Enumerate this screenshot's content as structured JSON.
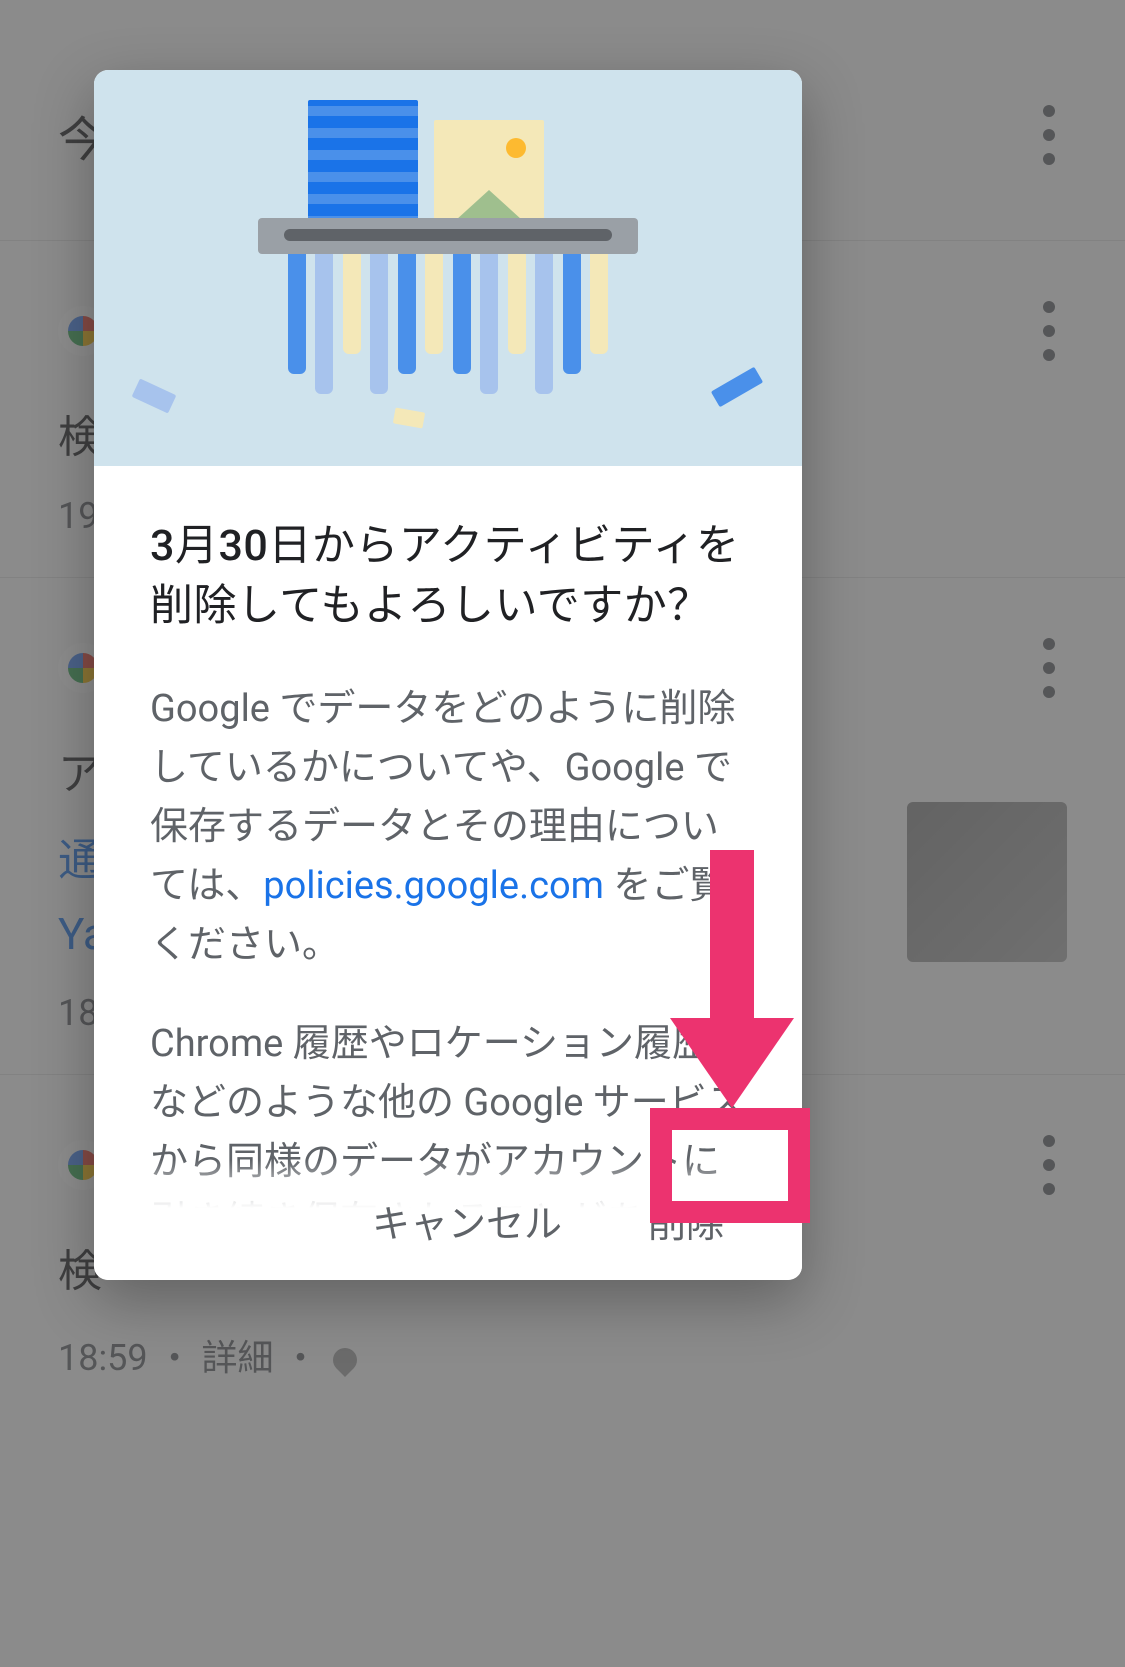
{
  "background": {
    "section_title": "今",
    "items": [
      {
        "label_prefix": "検",
        "time": "19",
        "link1": "通",
        "link2": "Ya"
      },
      {
        "label_prefix": "ア",
        "time": "18"
      },
      {
        "label_prefix": "検",
        "meta_time": "18:59",
        "meta_detail": "詳細"
      }
    ]
  },
  "modal": {
    "title": "3月30日からアクティビティを削除してもよろしいですか？",
    "para1_before": "Google でデータをどのように削除しているかについてや、Google で保存するデータとその理由については、",
    "para1_link": "policies.google.com",
    "para1_after": " をご覧ください。",
    "para2": "Chrome 履歴やロケーション履歴などのような他の Google サービスから同様のデータがアカウントに引き続き保存されることがあります。その他のアク",
    "cancel_label": "キャンセル",
    "confirm_label": "削除"
  },
  "annotation": {
    "color": "#ec336f"
  }
}
